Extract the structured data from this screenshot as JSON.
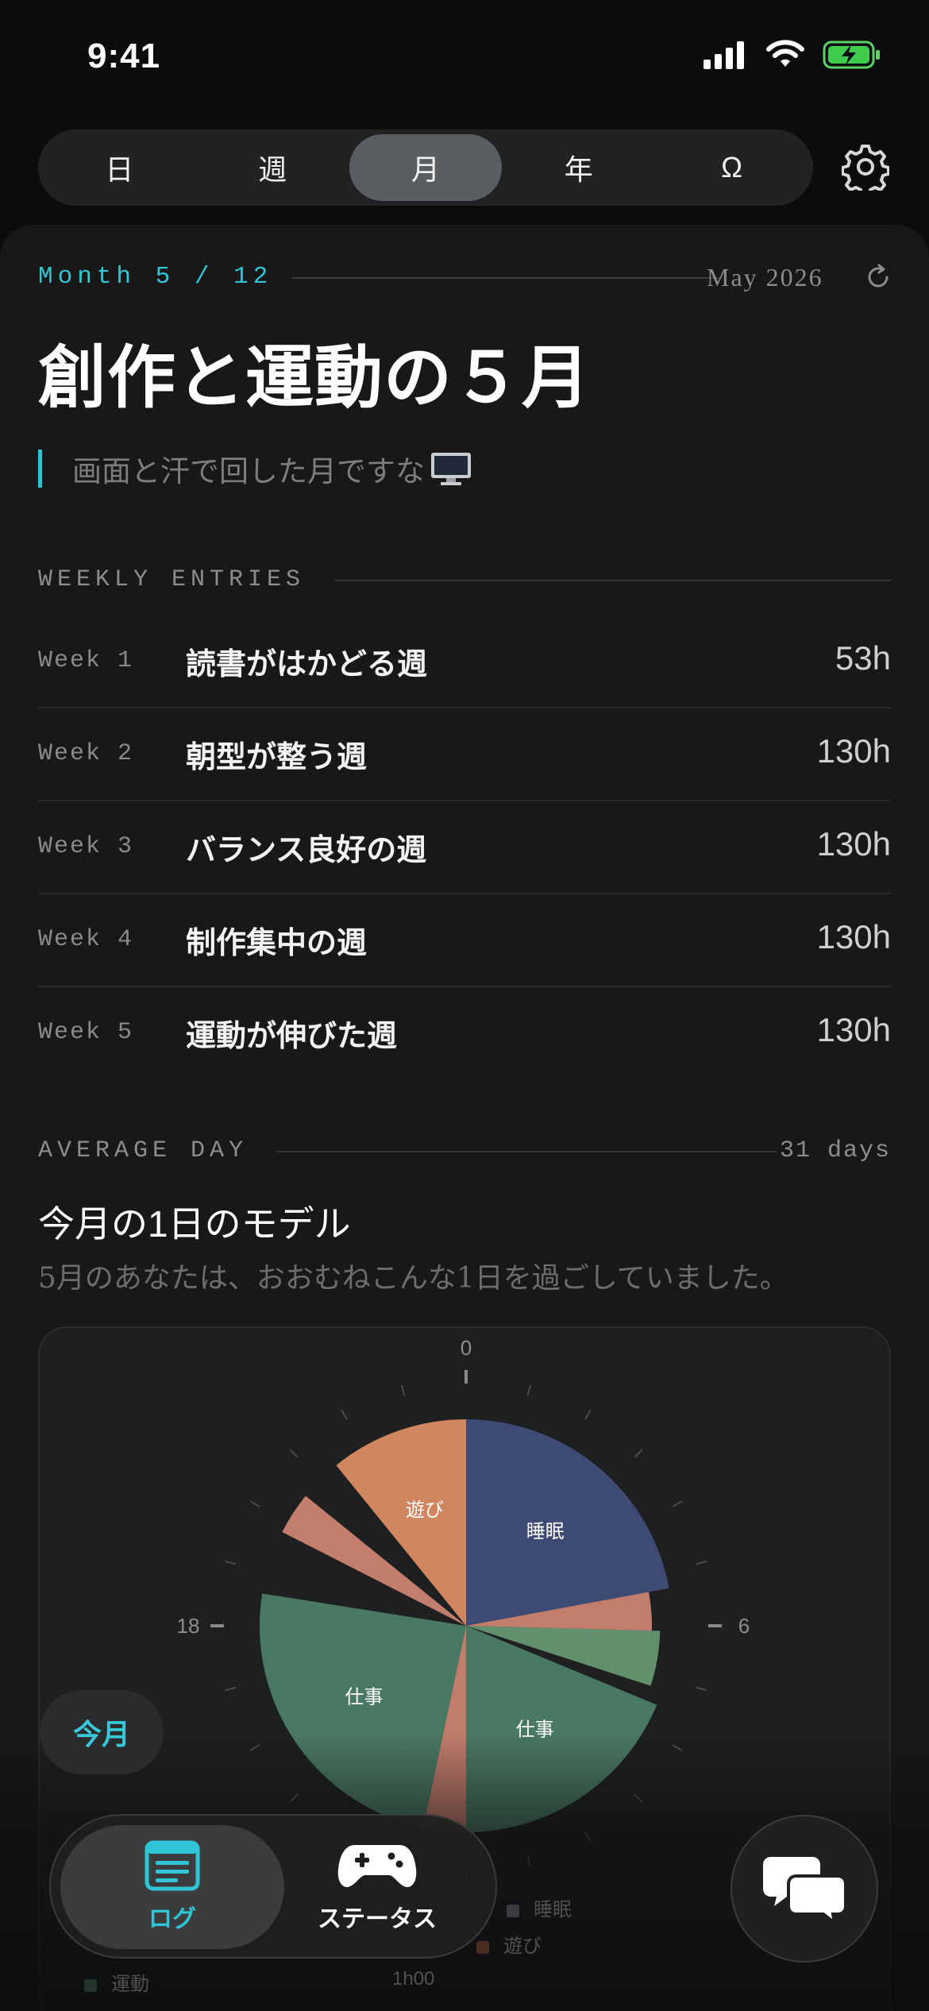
{
  "status_bar": {
    "time": "9:41"
  },
  "segments": [
    {
      "label": "日",
      "active": false
    },
    {
      "label": "週",
      "active": false
    },
    {
      "label": "月",
      "active": true
    },
    {
      "label": "年",
      "active": false
    },
    {
      "label": "Ω",
      "active": false
    }
  ],
  "header": {
    "month_label": "Month 5 / 12",
    "date": "May 2026",
    "title": "創作と運動の５月",
    "quote": "画面と汗で回した月ですな"
  },
  "weekly": {
    "section_label": "WEEKLY ENTRIES",
    "entries": [
      {
        "week": "Week 1",
        "name": "読書がはかどる週",
        "hours": "53h"
      },
      {
        "week": "Week 2",
        "name": "朝型が整う週",
        "hours": "130h"
      },
      {
        "week": "Week 3",
        "name": "バランス良好の週",
        "hours": "130h"
      },
      {
        "week": "Week 4",
        "name": "制作集中の週",
        "hours": "130h"
      },
      {
        "week": "Week 5",
        "name": "運動が伸びた週",
        "hours": "130h"
      }
    ]
  },
  "average": {
    "section_label": "AVERAGE DAY",
    "days": "31 days",
    "title": "今月の1日のモデル",
    "subtitle": "5月のあなたは、おおむねこんな1日を過ごしていました。"
  },
  "chart_data": {
    "type": "pie",
    "title": "",
    "hour_labels": [
      "0",
      "6",
      "18"
    ],
    "segments": [
      {
        "label": "睡眠",
        "start_hour": 0.0,
        "end_hour": 5.3,
        "color": "#3d4a74",
        "radius": 1.0
      },
      {
        "label": "",
        "start_hour": 5.3,
        "end_hour": 6.1,
        "color": "#c27d6c",
        "radius": 0.9
      },
      {
        "label": "",
        "start_hour": 6.1,
        "end_hour": 7.2,
        "color": "#62906d",
        "radius": 0.94
      },
      {
        "label": "",
        "start_hour": 7.2,
        "end_hour": 7.5,
        "color": "#1b1b1b",
        "radius": 0.0
      },
      {
        "label": "仕事",
        "start_hour": 7.5,
        "end_hour": 12.0,
        "color": "#4a7963",
        "radius": 1.0
      },
      {
        "label": "",
        "start_hour": 12.0,
        "end_hour": 12.8,
        "color": "#c27d6c",
        "radius": 1.0
      },
      {
        "label": "仕事",
        "start_hour": 12.8,
        "end_hour": 18.6,
        "color": "#4a7963",
        "radius": 1.0
      },
      {
        "label": "",
        "start_hour": 18.6,
        "end_hour": 19.8,
        "color": "#1b1b1b",
        "radius": 0.0
      },
      {
        "label": "",
        "start_hour": 19.8,
        "end_hour": 20.6,
        "color": "#c27d6c",
        "radius": 1.0
      },
      {
        "label": "",
        "start_hour": 20.6,
        "end_hour": 21.4,
        "color": "#1b1b1b",
        "radius": 0.0
      },
      {
        "label": "遊び",
        "start_hour": 21.4,
        "end_hour": 24.0,
        "color": "#d08760",
        "radius": 1.0
      }
    ],
    "legend": [
      "睡眠",
      "遊び",
      "運動"
    ],
    "legend_colors": [
      "#3d4a74",
      "#d08760",
      "#4a7963"
    ],
    "extra_text": "1h00"
  },
  "bottom": {
    "month_pill": "今月",
    "tabs": [
      {
        "label": "ログ",
        "icon": "log-icon",
        "active": true
      },
      {
        "label": "ステータス",
        "icon": "gamepad-icon",
        "active": false
      }
    ],
    "chat_icon": "chat-bubbles-icon"
  },
  "colors": {
    "accent": "#2fc5d6",
    "background": "#0b0c0d",
    "card": "#181818"
  }
}
